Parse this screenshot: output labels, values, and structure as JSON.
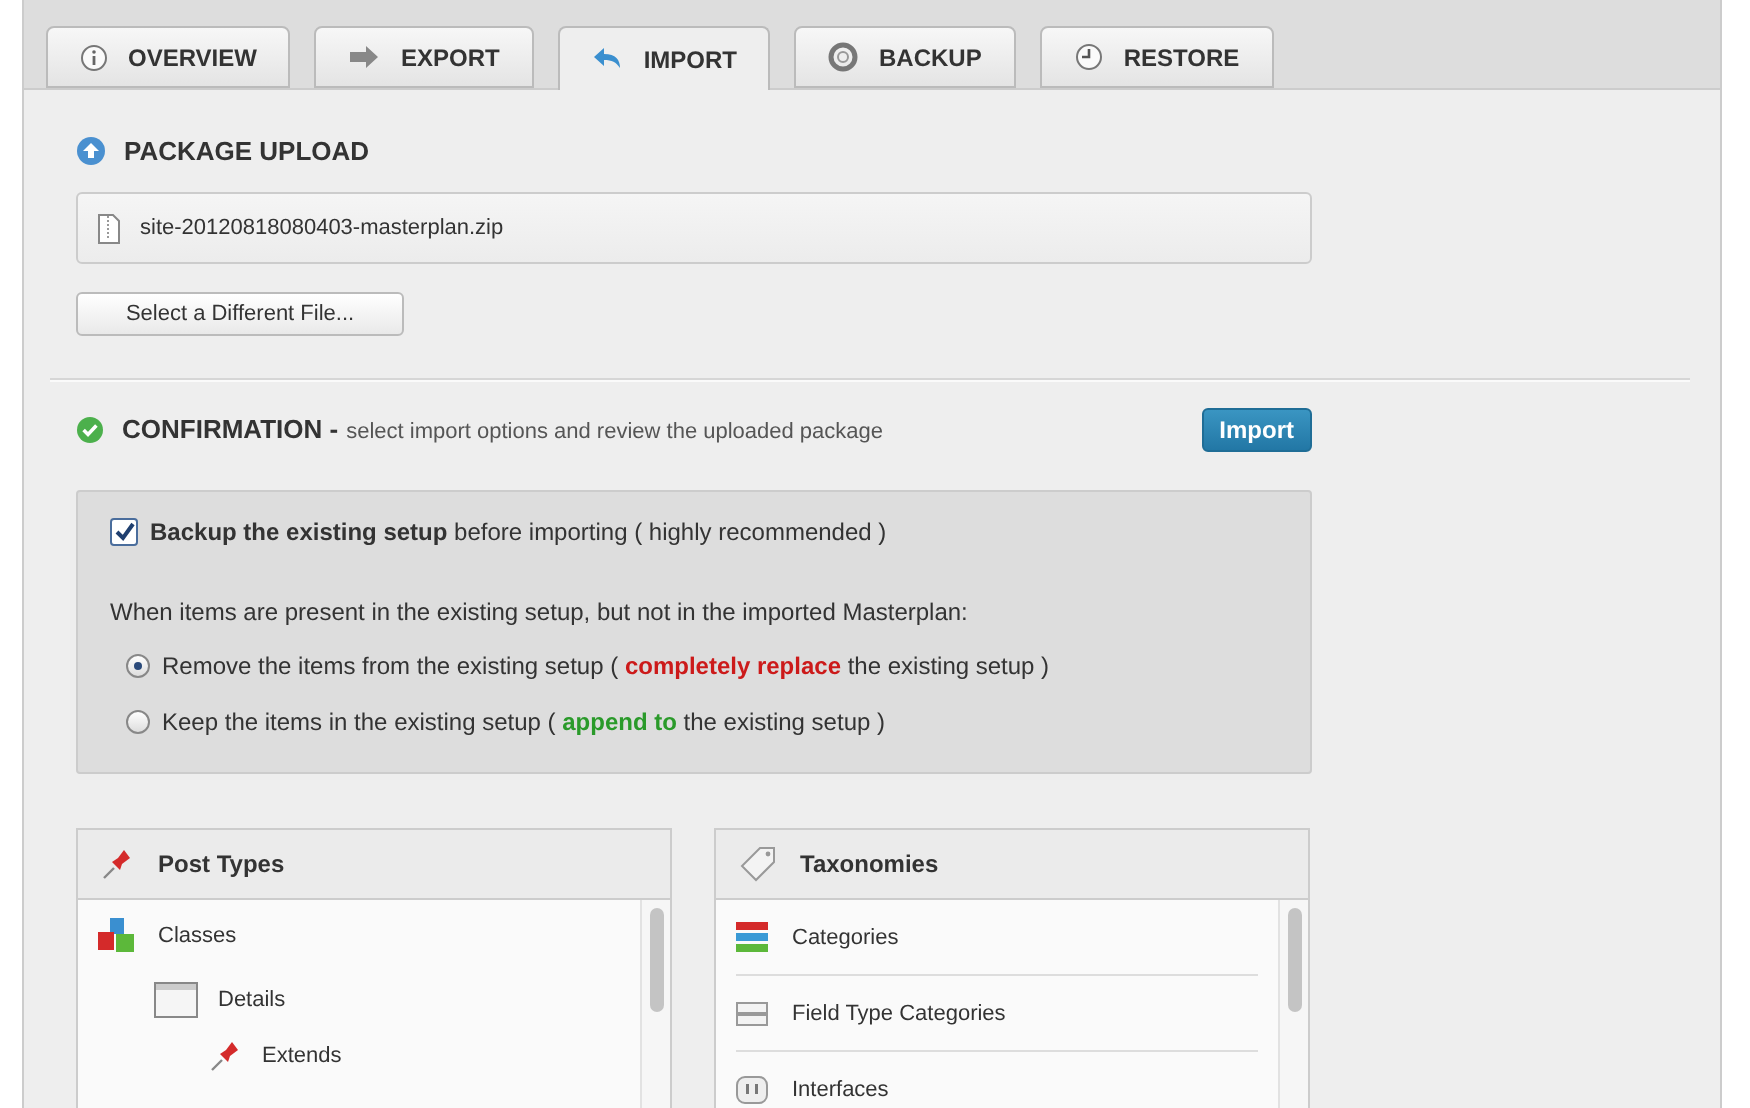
{
  "tabs": [
    {
      "label": "OVERVIEW",
      "kind": "info",
      "selected": false
    },
    {
      "label": "EXPORT",
      "kind": "export",
      "selected": false
    },
    {
      "label": "IMPORT",
      "kind": "import",
      "selected": true
    },
    {
      "label": "BACKUP",
      "kind": "lifebuoy",
      "selected": false
    },
    {
      "label": "RESTORE",
      "kind": "clock",
      "selected": false
    }
  ],
  "upload": {
    "heading": "PACKAGE UPLOAD",
    "file_name": "site-20120818080403-masterplan.zip",
    "select_button": "Select a Different File..."
  },
  "confirmation": {
    "heading": "CONFIRMATION -",
    "subtitle": "select import options and review the uploaded package",
    "import_button": "Import",
    "backup": {
      "label": "**Backup the existing setup** before importing ( highly recommended )",
      "checked": true
    },
    "question": "When items are present in the existing setup, but not in the imported Masterplan:",
    "options": [
      {
        "before": "Remove the items from the existing setup ( ",
        "emphasis": "completely replace",
        "after": " the existing setup )",
        "color": "#cc1a1a",
        "selected": true
      },
      {
        "before": "Keep the items in the existing setup ( ",
        "emphasis": "append to",
        "after": " the existing setup )",
        "color": "#2a9a2a",
        "selected": false
      }
    ]
  },
  "post_types": {
    "title": "Post Types",
    "items": [
      {
        "label": "Classes",
        "kind": "blocks",
        "children": [
          {
            "label": "Details",
            "kind": "window",
            "children": [
              {
                "label": "Extends",
                "kind": "pin"
              }
            ]
          }
        ]
      }
    ]
  },
  "taxonomies": {
    "title": "Taxonomies",
    "items": [
      {
        "label": "Categories",
        "kind": "stack"
      },
      {
        "label": "Field Type Categories",
        "kind": "drawers"
      },
      {
        "label": "Interfaces",
        "kind": "plug"
      }
    ]
  }
}
